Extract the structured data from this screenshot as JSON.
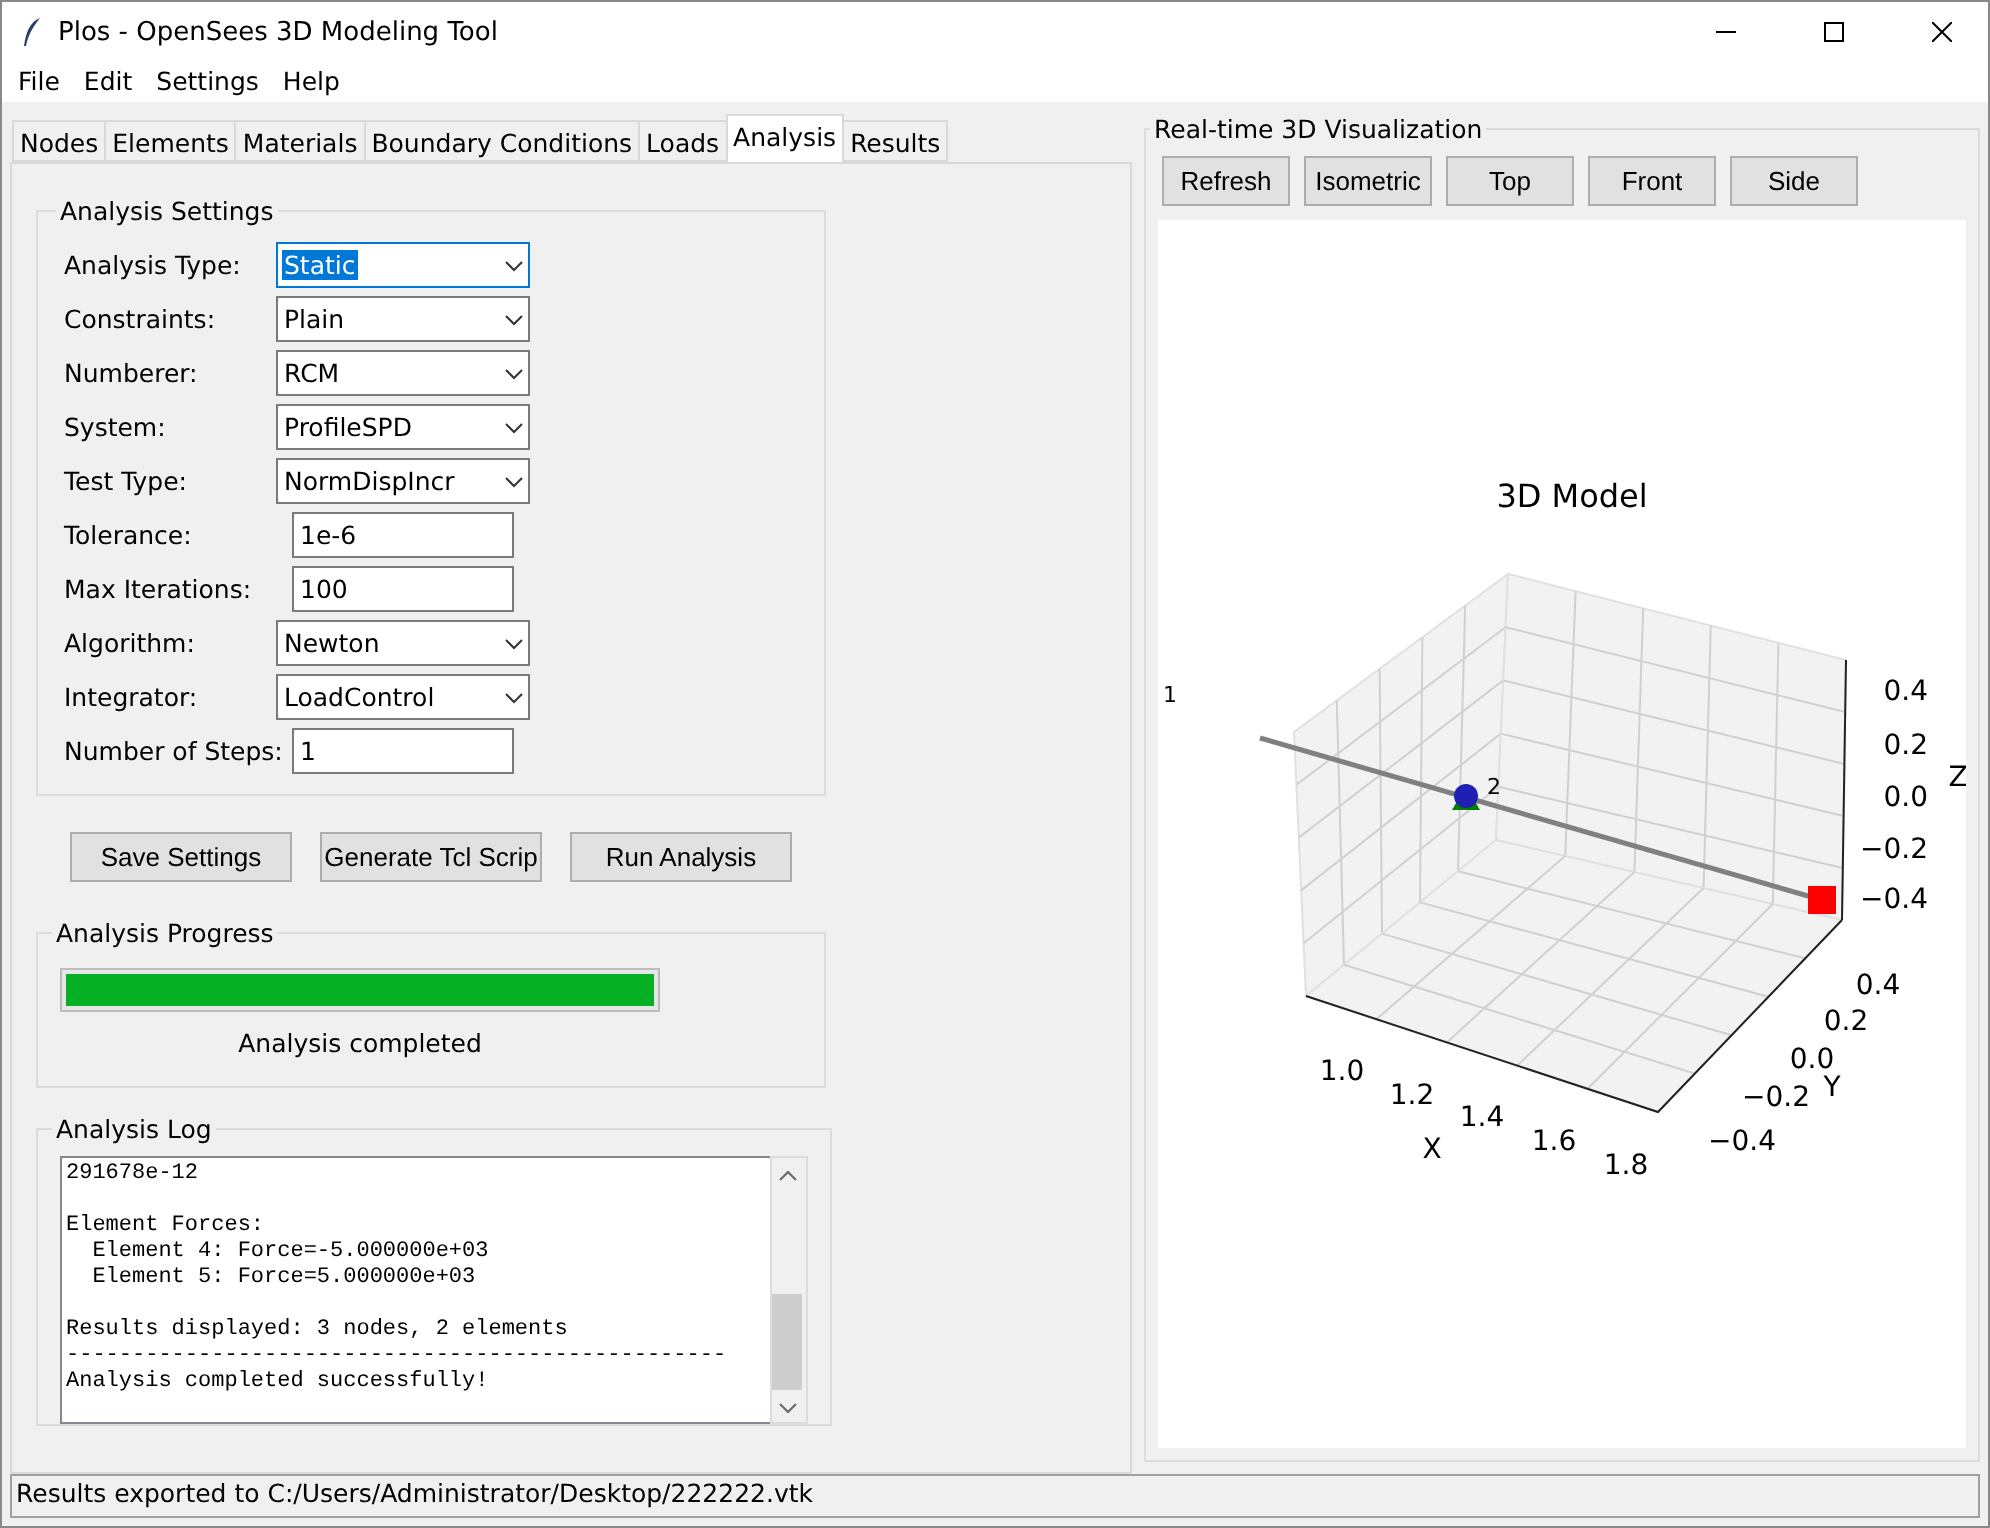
{
  "window": {
    "title": "Plos - OpenSees 3D Modeling Tool"
  },
  "menu": [
    "File",
    "Edit",
    "Settings",
    "Help"
  ],
  "tabs": [
    {
      "label": "Nodes",
      "selected": false
    },
    {
      "label": "Elements",
      "selected": false
    },
    {
      "label": "Materials",
      "selected": false
    },
    {
      "label": "Boundary Conditions",
      "selected": false
    },
    {
      "label": "Loads",
      "selected": false
    },
    {
      "label": "Analysis",
      "selected": true
    },
    {
      "label": "Results",
      "selected": false
    }
  ],
  "settings": {
    "title": "Analysis Settings",
    "fields": [
      {
        "label": "Analysis Type:",
        "value": "Static",
        "kind": "combo",
        "focused": true
      },
      {
        "label": "Constraints:",
        "value": "Plain",
        "kind": "combo",
        "focused": false
      },
      {
        "label": "Numberer:",
        "value": "RCM",
        "kind": "combo",
        "focused": false
      },
      {
        "label": "System:",
        "value": "ProfileSPD",
        "kind": "combo",
        "focused": false
      },
      {
        "label": "Test Type:",
        "value": "NormDispIncr",
        "kind": "combo",
        "focused": false
      },
      {
        "label": "Tolerance:",
        "value": "1e-6",
        "kind": "entry",
        "focused": false
      },
      {
        "label": "Max Iterations:",
        "value": "100",
        "kind": "entry",
        "focused": false
      },
      {
        "label": "Algorithm:",
        "value": "Newton",
        "kind": "combo",
        "focused": false
      },
      {
        "label": "Integrator:",
        "value": "LoadControl",
        "kind": "combo",
        "focused": false
      },
      {
        "label": "Number of Steps:",
        "value": "1",
        "kind": "entry",
        "focused": false
      }
    ]
  },
  "actions": [
    "Save Settings",
    "Generate Tcl Scrip",
    "Run Analysis"
  ],
  "progress": {
    "title": "Analysis Progress",
    "level": 1,
    "status": "Analysis completed"
  },
  "log": {
    "title": "Analysis Log",
    "blocks": [
      [
        "291678e-12"
      ],
      [
        "Element Forces:",
        "  Element 4: Force=-5.000000e+03",
        "  Element 5: Force=5.000000e+03"
      ],
      [
        "Results displayed: 3 nodes, 2 elements",
        "--------------------------------------------------",
        "Analysis completed successfully!"
      ]
    ]
  },
  "visualization": {
    "title": "Real-time 3D Visualization",
    "buttons": [
      "Refresh",
      "Isometric",
      "Top",
      "Front",
      "Side"
    ],
    "plot": {
      "title": "3D Model",
      "x_label": "X",
      "y_label": "Y",
      "z_label": "Z",
      "x_ticks": [
        "1.0",
        "1.2",
        "1.4",
        "1.6",
        "1.8"
      ],
      "y_ticks": [
        "0.4",
        "0.2",
        "0.0",
        "−0.2",
        "−0.4"
      ],
      "z_ticks": [
        "0.4",
        "0.2",
        "0.0",
        "−0.2",
        "−0.4"
      ],
      "node_labels": [
        "1",
        "2"
      ]
    }
  },
  "status_bar": "Results exported to C:/Users/Administrator/Desktop/222222.vtk"
}
